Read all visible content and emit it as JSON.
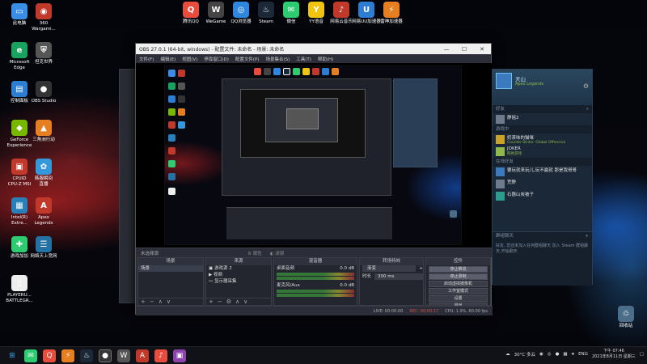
{
  "desktop_icons_left": [
    {
      "label": "此电脑",
      "glyph": "▭",
      "color": "#3a8ee6"
    },
    {
      "label": "360\nWargami...",
      "glyph": "◉",
      "color": "#c0392b"
    },
    {
      "label": "Microsoft\nEdge",
      "glyph": "e",
      "color": "#1aa260"
    },
    {
      "label": "坦克世界",
      "glyph": "⛨",
      "color": "#555"
    },
    {
      "label": "控制面板",
      "glyph": "▤",
      "color": "#2d7dd2"
    },
    {
      "label": "OBS Studio",
      "glyph": "●",
      "color": "#333"
    },
    {
      "label": "GeForce\nExperience",
      "glyph": "◆",
      "color": "#76b900"
    },
    {
      "label": "三角洲行动",
      "glyph": "▲",
      "color": "#e67e22"
    },
    {
      "label": "CPUID\nCPU-Z MSI",
      "glyph": "▣",
      "color": "#c0392b"
    },
    {
      "label": "韩服瞬间\n直播",
      "glyph": "✿",
      "color": "#3498db"
    },
    {
      "label": "Intel(R)\nExtre...",
      "glyph": "▦",
      "color": "#2980b9"
    },
    {
      "label": "Apex\nLegends",
      "glyph": "A",
      "color": "#c0392b"
    },
    {
      "label": "游戏加加",
      "glyph": "✚",
      "color": "#2ecc71"
    },
    {
      "label": "网络天上竞网",
      "glyph": "☰",
      "color": "#2471a3"
    },
    {
      "label": "PLAYERU...\nBATTLEGR...",
      "glyph": "▯",
      "color": "#eee"
    }
  ],
  "desktop_icons_top": [
    {
      "label": "腾讯QQ",
      "glyph": "Q",
      "color": "#e74c3c"
    },
    {
      "label": "WeGame",
      "glyph": "W",
      "color": "#444"
    },
    {
      "label": "QQ浏览器",
      "glyph": "◎",
      "color": "#2e86de"
    },
    {
      "label": "Steam",
      "glyph": "♨",
      "color": "#1b2838"
    },
    {
      "label": "微信",
      "glyph": "✉",
      "color": "#2ecc71"
    },
    {
      "label": "YY语音",
      "glyph": "Y",
      "color": "#f1c40f"
    },
    {
      "label": "网易云音乐",
      "glyph": "♪",
      "color": "#c0392b"
    },
    {
      "label": "网易UU加速器",
      "glyph": "U",
      "color": "#2d7dd2"
    },
    {
      "label": "雷神加速器",
      "glyph": "⚡",
      "color": "#e67e22"
    }
  ],
  "recycle_bin": {
    "label": "回收站",
    "glyph": "♲"
  },
  "obs": {
    "title": "OBS 27.0.1 (64-bit, windows) - 配置文件: 未命名 - 场景: 未命名",
    "controls": [
      "—",
      "☐",
      "✕"
    ],
    "menu": [
      "文件(F)",
      "编辑(E)",
      "视图(V)",
      "停靠窗口(D)",
      "配置文件(P)",
      "场景集合(S)",
      "工具(T)",
      "帮助(H)"
    ],
    "status_line": {
      "source": "未选择源",
      "properties": "属性",
      "filters": "滤镜"
    },
    "docks": {
      "scenes": {
        "header": "场景",
        "items": [
          "场景"
        ]
      },
      "sources": {
        "header": "来源",
        "items": [
          "游戏源 2",
          "视频",
          "显示器采集"
        ]
      },
      "mixer": {
        "header": "混音器",
        "tracks": [
          {
            "name": "桌面音频",
            "level": "0.0 dB"
          },
          {
            "name": "麦克风/Aux",
            "level": "0.0 dB"
          }
        ]
      },
      "transitions": {
        "header": "转场特效",
        "fade": "渐变",
        "duration_label": "时长",
        "duration_value": "300 ms"
      },
      "controls": {
        "header": "控件",
        "buttons": [
          "停止推流",
          "停止录制",
          "启动虚拟摄像机",
          "工作室模式",
          "设置",
          "退出"
        ]
      }
    },
    "bottom_status": {
      "live": "LIVE: 00:00:00",
      "rec": "REC: 00:00:17",
      "cpu": "CPU: 1.9%, 60.00 fps"
    }
  },
  "steam": {
    "username": "天山",
    "game": "Apex Legends",
    "sections": {
      "friends": "好友",
      "in_game": "游戏中",
      "online": "在线好友",
      "group_chat": "群组聊天"
    },
    "friends": [
      {
        "name": "静姐2",
        "status": "",
        "color": "#6e7b8c"
      },
      {
        "name": "奶茶味的猫咪",
        "status": "Counter-Strike: Global Offensive",
        "color": "#c9a227"
      },
      {
        "name": "JOKER",
        "status": "网易游戏",
        "color": "#8fb94b"
      },
      {
        "name": "要玩就来玩儿,玩不赢就 那是我哥哥",
        "status": "",
        "color": "#3a7abd"
      },
      {
        "name": "荒野",
        "status": "",
        "color": "#6e7b8c"
      },
      {
        "name": "石器山炭被子",
        "status": "",
        "color": "#2a9d8f"
      }
    ],
    "group_chat_hint": "好友, 您还未加入任何群组聊天 加入 Steam 群组聊天,开始聊天"
  },
  "taskbar": {
    "weather": "30°C 多云",
    "lang": "ENG",
    "time": "下午 07:46",
    "date": "2021年8月11日 星期三"
  }
}
